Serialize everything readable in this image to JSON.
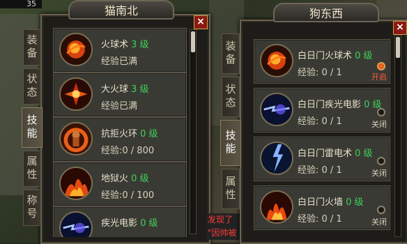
{
  "hud": {
    "level": "35"
  },
  "left_panel": {
    "title": "猫南北",
    "close": "×",
    "tabs": [
      "装备",
      "状态",
      "技能",
      "属性",
      "称号"
    ],
    "active_tab": 2,
    "skills": [
      {
        "name": "火球术",
        "level": "3 级",
        "exp": "经验已满",
        "icon": "fireball-icon"
      },
      {
        "name": "大火球",
        "level": "3 级",
        "exp": "经验已满",
        "icon": "big-fireball-icon"
      },
      {
        "name": "抗拒火环",
        "level": "0 级",
        "exp": "经验:0 / 800",
        "icon": "fire-ring-icon"
      },
      {
        "name": "地狱火",
        "level": "0 级",
        "exp": "经验:0 / 100",
        "icon": "hellfire-icon"
      },
      {
        "name": "疾光电影",
        "level": "0 级",
        "exp": "",
        "icon": "lightning-beam-icon"
      }
    ]
  },
  "right_panel": {
    "title": "狗东西",
    "close": "×",
    "tabs": [
      "装备",
      "状态",
      "技能",
      "属性"
    ],
    "active_tab": 2,
    "skills": [
      {
        "name": "白日门火球术",
        "level": "0 级",
        "exp": "经验: 0 / 1",
        "toggle": "开启",
        "on": true,
        "icon": "fireball-icon"
      },
      {
        "name": "白日门疾光电影",
        "level": "0 级",
        "exp": "经验: 0 / 1",
        "toggle": "关闭",
        "on": false,
        "icon": "lightning-beam-icon"
      },
      {
        "name": "白日门雷电术",
        "level": "0 级",
        "exp": "经验: 0 / 1",
        "toggle": "关闭",
        "on": false,
        "icon": "thunder-icon"
      },
      {
        "name": "白日门火墙",
        "level": "0 级",
        "exp": "经验: 0 / 1",
        "toggle": "关闭",
        "on": false,
        "icon": "firewall-icon"
      }
    ]
  },
  "chat": {
    "lines": [
      "发现了",
      "\"因帅被"
    ]
  },
  "colors": {
    "level_green": "#3fd15b",
    "toggle_on": "#ff5a3a",
    "close_red": "#8a1a12"
  }
}
